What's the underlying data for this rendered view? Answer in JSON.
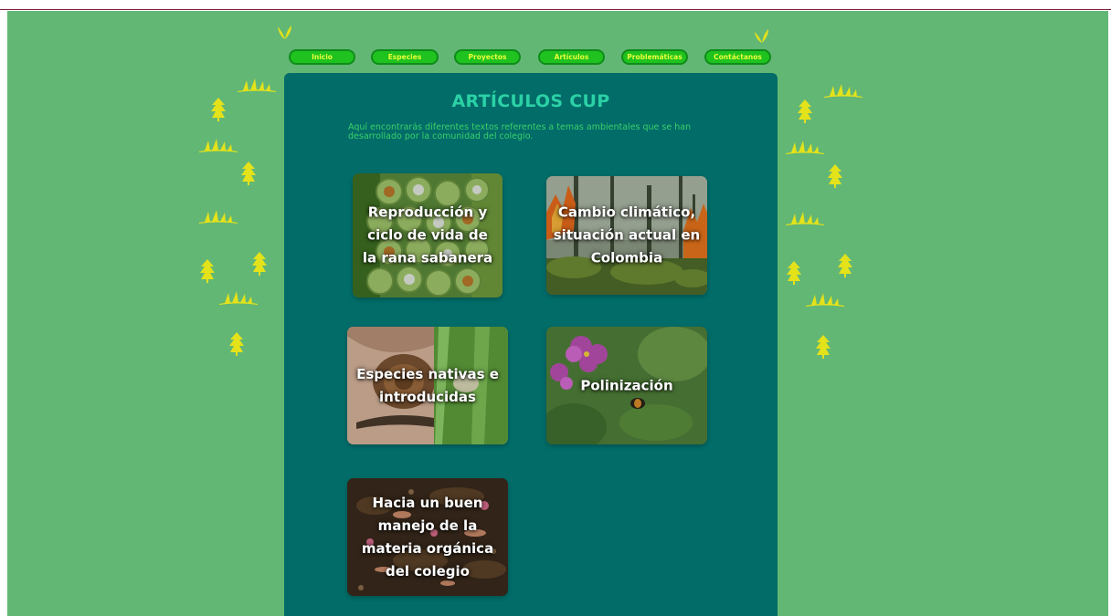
{
  "nav": {
    "items": [
      "Inicio",
      "Especies",
      "Proyectos",
      "Artículos",
      "Problemáticas",
      "Contáctanos"
    ]
  },
  "header": {
    "title": "ARTÍCULOS CUP",
    "subtitle": "Aquí encontrarás diferentes textos referentes a temas ambientales que se han desarrollado por la comunidad del colegio."
  },
  "articles": [
    {
      "label": "Reproducción y ciclo de vida de la rana sabanera"
    },
    {
      "label": "Cambio climático, situación actual en Colombia"
    },
    {
      "label": "Especies nativas e introducidas"
    },
    {
      "label": "Polinización"
    },
    {
      "label": "Hacia un buen manejo de la materia orgánica del colegio"
    }
  ],
  "colors": {
    "page_bg": "#62b774",
    "panel_bg": "#016c68",
    "title": "#2bd1a6",
    "nav_button": "#1fc21f",
    "nav_text": "#eaff3a",
    "decor_leaf": "#e4e21a"
  },
  "icons": [
    "leaf-sprout-icon",
    "fern-leaf-icon",
    "pine-leaf-icon"
  ]
}
